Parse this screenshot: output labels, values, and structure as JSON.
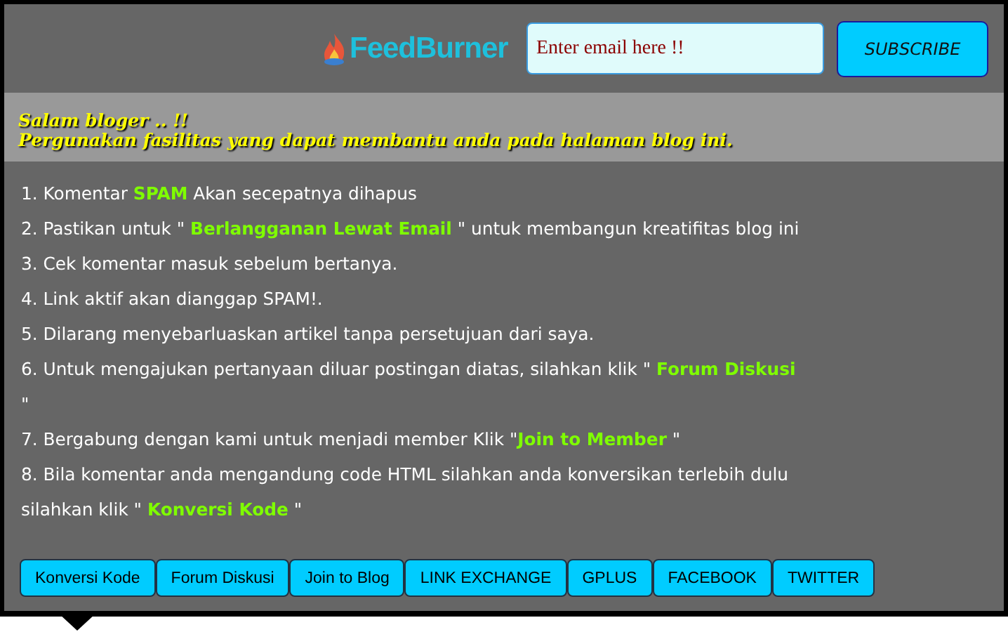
{
  "header": {
    "logo_text": "FeedBurner",
    "email_field": {
      "placeholder": "Enter email here !!"
    },
    "subscribe_button": "SUBSCRIBE"
  },
  "banner": {
    "greeting": "Salam bloger .. !!",
    "subtitle": "Pergunakan fasilitas yang dapat membantu anda pada halaman blog ini."
  },
  "rules": [
    {
      "parts": [
        {
          "kind": "text",
          "text": "1. Komentar "
        },
        {
          "kind": "link",
          "text": "SPAM"
        },
        {
          "kind": "text",
          "text": " Akan secepatnya dihapus"
        }
      ]
    },
    {
      "parts": [
        {
          "kind": "text",
          "text": "2. Pastikan untuk \" "
        },
        {
          "kind": "link",
          "text": "Berlangganan Lewat Email"
        },
        {
          "kind": "text",
          "text": " \" untuk membangun kreatifitas blog ini"
        }
      ]
    },
    {
      "parts": [
        {
          "kind": "text",
          "text": "3. Cek komentar masuk sebelum bertanya."
        }
      ]
    },
    {
      "parts": [
        {
          "kind": "text",
          "text": "4. Link aktif akan dianggap SPAM!."
        }
      ]
    },
    {
      "parts": [
        {
          "kind": "text",
          "text": "5. Dilarang menyebarluaskan artikel tanpa persetujuan dari saya."
        }
      ]
    },
    {
      "parts": [
        {
          "kind": "text",
          "text": "6. Untuk mengajukan pertanyaan diluar postingan diatas, silahkan klik \" "
        },
        {
          "kind": "link",
          "text": "Forum Diskusi"
        },
        {
          "kind": "text",
          "text": " \""
        }
      ]
    },
    {
      "parts": [
        {
          "kind": "text",
          "text": "7. Bergabung dengan kami untuk menjadi member Klik \""
        },
        {
          "kind": "link",
          "text": "Join to Member"
        },
        {
          "kind": "text",
          "text": " \""
        }
      ]
    },
    {
      "parts": [
        {
          "kind": "text",
          "text": "8. Bila komentar anda mengandung code HTML silahkan anda konversikan terlebih dulu silahkan klik \" "
        },
        {
          "kind": "link",
          "text": "Konversi Kode"
        },
        {
          "kind": "text",
          "text": " \""
        }
      ]
    }
  ],
  "tabs": [
    "Konversi Kode",
    "Forum Diskusi",
    "Join to Blog",
    "LINK EXCHANGE",
    "GPLUS",
    "FACEBOOK",
    "TWITTER"
  ]
}
